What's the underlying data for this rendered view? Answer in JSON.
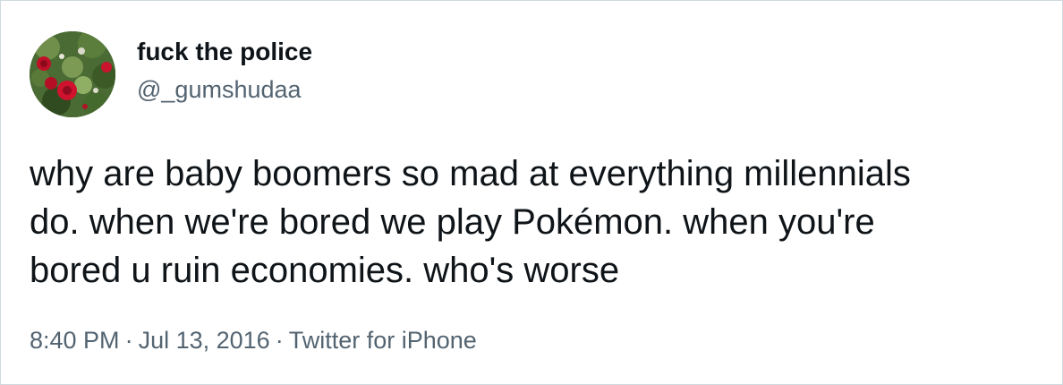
{
  "tweet": {
    "display_name": "fuck the police",
    "handle": "@_gumshudaa",
    "avatar_icon": "rose-bush-avatar",
    "text": "why are baby boomers so mad at everything millennials\ndo. when we're bored we play Pokémon. when you're\nbored u ruin economies. who's worse",
    "time": "8:40 PM",
    "separator": "·",
    "date": "Jul 13, 2016",
    "source": "Twitter for iPhone"
  },
  "colors": {
    "text_primary": "#0f1419",
    "text_secondary": "#536471",
    "border": "#cfd9de"
  }
}
